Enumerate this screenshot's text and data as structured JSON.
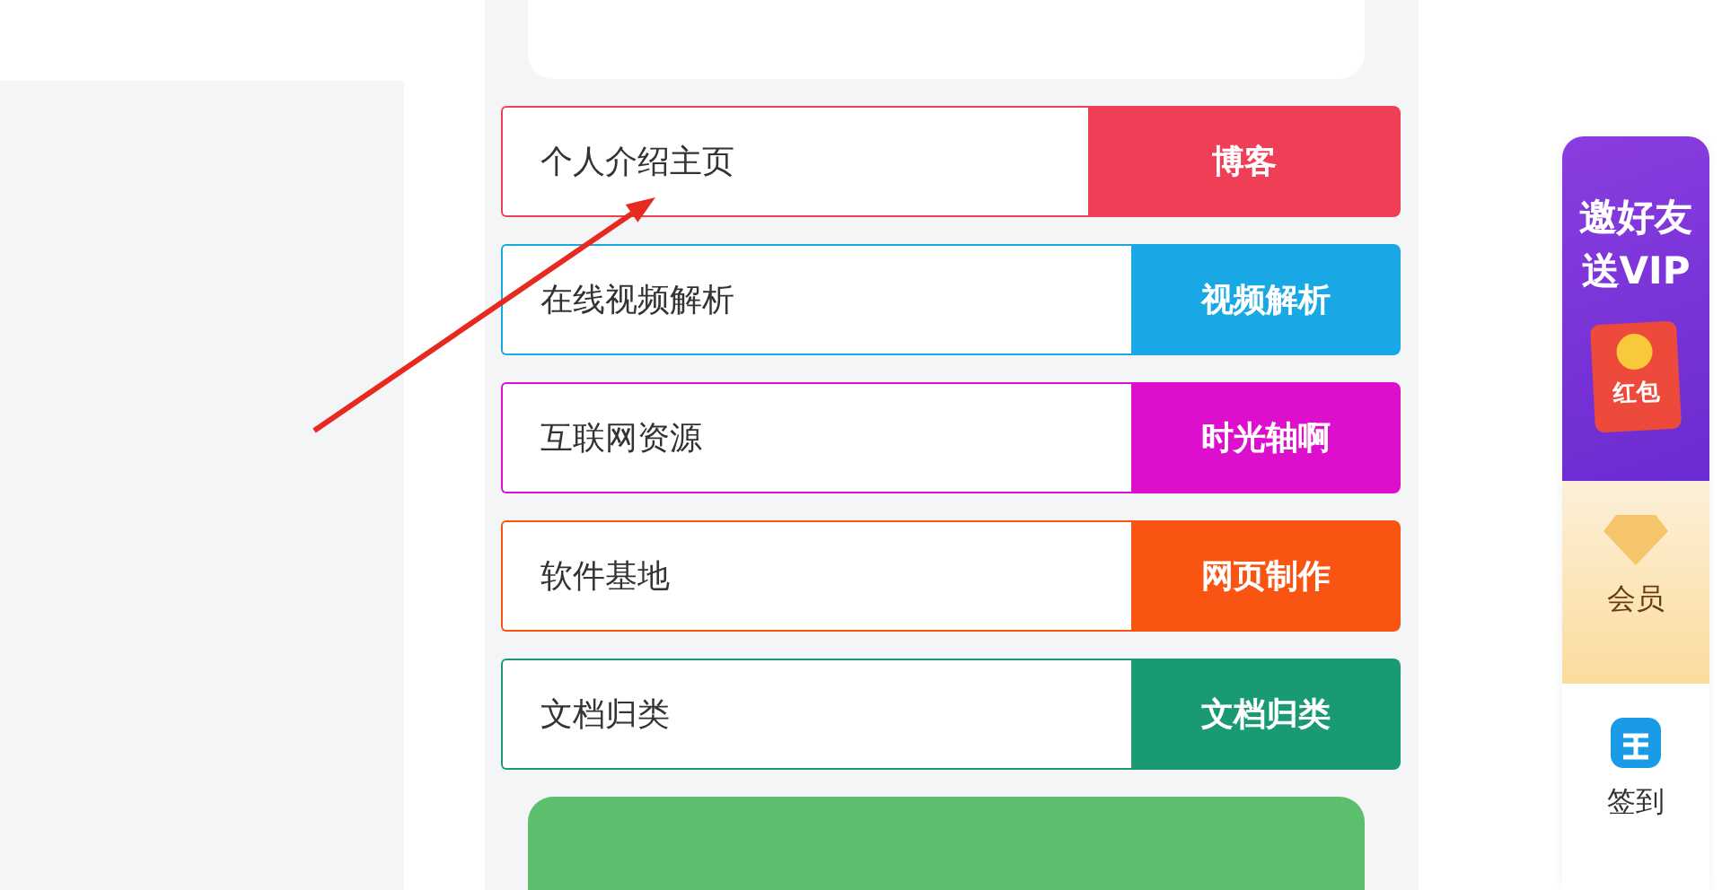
{
  "links": [
    {
      "label": "个人介绍主页",
      "button": "博客",
      "color": "#ef3e55"
    },
    {
      "label": "在线视频解析",
      "button": "视频解析",
      "color": "#18a8e6"
    },
    {
      "label": "互联网资源",
      "button": "时光轴啊",
      "color": "#dd0fcc"
    },
    {
      "label": "软件基地",
      "button": "网页制作",
      "color": "#fa5412"
    },
    {
      "label": "文档归类",
      "button": "文档归类",
      "color": "#1a9a72"
    }
  ],
  "sidebar": {
    "promo_title": [
      "邀好友",
      "送VIP"
    ],
    "red_packet": "红包",
    "vip": "会员",
    "sign_in": "签到"
  }
}
